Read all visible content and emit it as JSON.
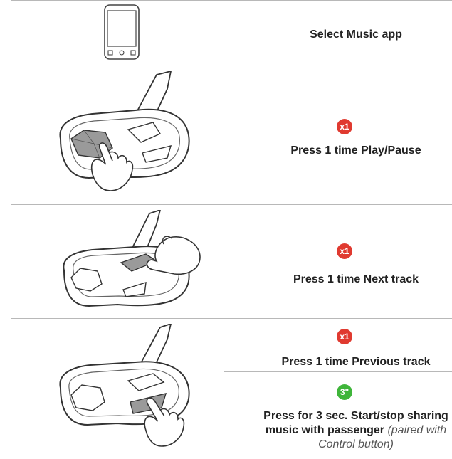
{
  "rows": [
    {
      "text": "Select Music app",
      "icon": "smartphone-icon"
    },
    {
      "badge": "x1",
      "badge_color": "#e03a30",
      "text": "Press 1 time Play/Pause",
      "icon": "intercom-device-press-large-button-icon"
    },
    {
      "badge": "x1",
      "badge_color": "#e03a30",
      "text": "Press 1 time Next track",
      "icon": "intercom-device-press-center-button-icon"
    },
    {
      "icon": "intercom-device-press-small-button-icon",
      "sub": [
        {
          "badge": "x1",
          "badge_color": "#e03a30",
          "text": "Press 1 time Previous track"
        },
        {
          "badge": "3\"",
          "badge_color": "#3fb53a",
          "text_bold": "Press for 3 sec. Start/stop sharing",
          "text_bold2": "music with passenger",
          "text_italic": "(paired with",
          "text_italic2": "Control button)"
        }
      ]
    }
  ]
}
